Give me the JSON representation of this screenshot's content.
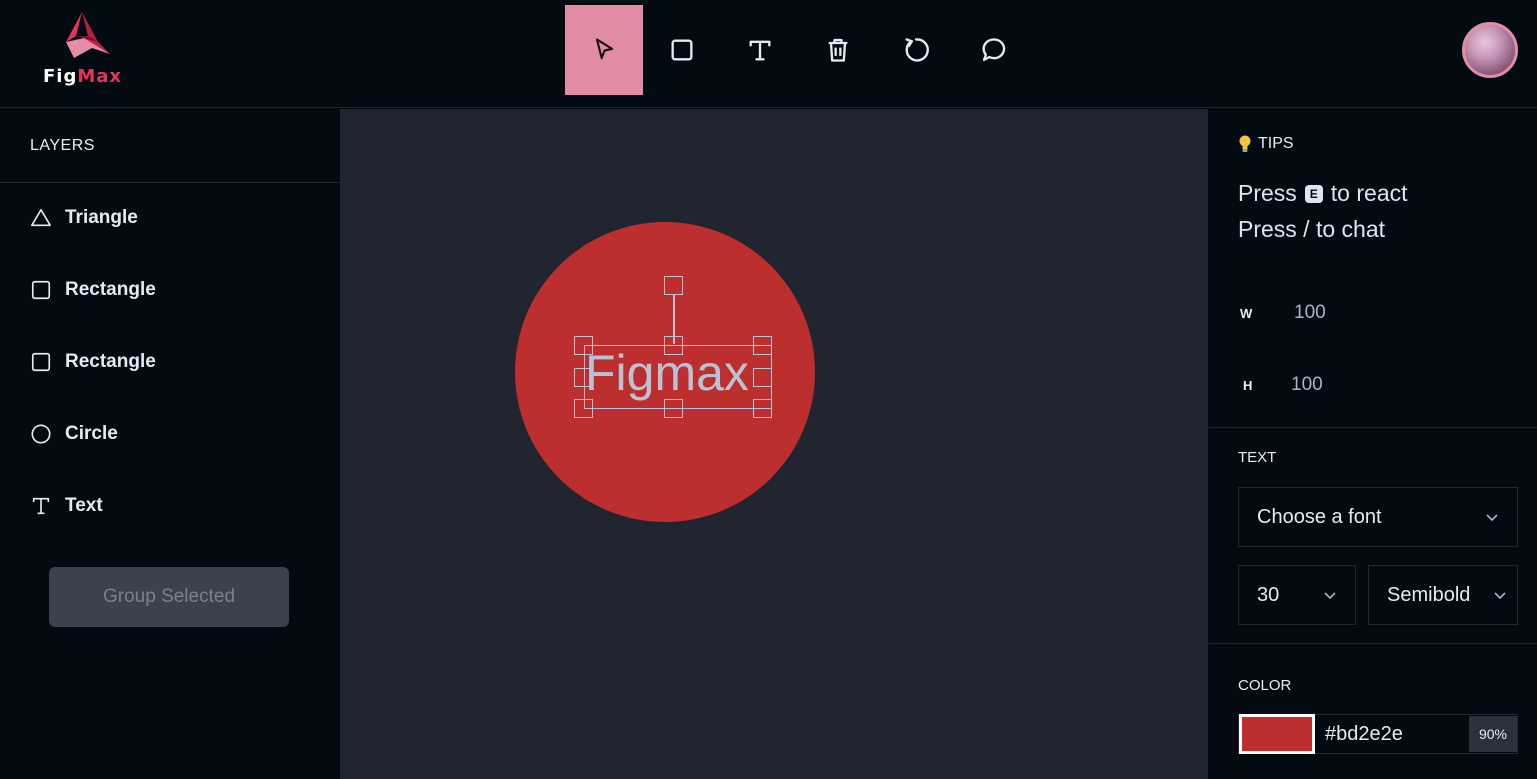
{
  "app": {
    "logo_part1": "Fig",
    "logo_part2": "Max"
  },
  "toolbar": {
    "tools": [
      {
        "name": "select",
        "icon": "cursor-icon",
        "active": true
      },
      {
        "name": "rectangle",
        "icon": "square-icon",
        "active": false
      },
      {
        "name": "text",
        "icon": "text-icon",
        "active": false
      },
      {
        "name": "delete",
        "icon": "trash-icon",
        "active": false
      },
      {
        "name": "reset",
        "icon": "reset-icon",
        "active": false
      },
      {
        "name": "comments",
        "icon": "chat-icon",
        "active": false
      }
    ],
    "active_color": "#e08ca4"
  },
  "layers": {
    "title": "LAYERS",
    "items": [
      {
        "label": "Triangle",
        "icon": "triangle-icon"
      },
      {
        "label": "Rectangle",
        "icon": "square-icon"
      },
      {
        "label": "Rectangle",
        "icon": "square-icon"
      },
      {
        "label": "Circle",
        "icon": "circle-icon"
      },
      {
        "label": "Text",
        "icon": "text-icon"
      }
    ],
    "group_button": "Group Selected"
  },
  "canvas": {
    "background": "#20252f",
    "circle_fill": "#bd2e2e",
    "text_object": "Figmax"
  },
  "tips": {
    "title": "TIPS",
    "line1_before": "Press",
    "line1_key": "E",
    "line1_after": "to react",
    "line2": "Press / to chat"
  },
  "dimensions": {
    "w_label": "W",
    "w_value": "100",
    "h_label": "H",
    "h_value": "100"
  },
  "text_section": {
    "title": "TEXT",
    "font_placeholder": "Choose a font",
    "font_size": "30",
    "font_weight": "Semibold"
  },
  "color_section": {
    "title": "COLOR",
    "hex": "#bd2e2e",
    "opacity": "90%"
  }
}
